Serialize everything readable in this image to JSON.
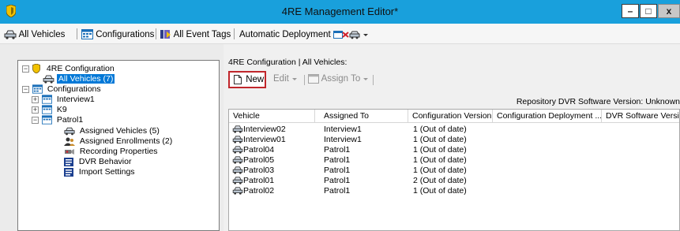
{
  "window": {
    "title": "4RE Management Editor*",
    "minimize": "–",
    "maximize": "□",
    "close": "x"
  },
  "toolbar": {
    "all_vehicles": "All Vehicles",
    "configurations": "Configurations",
    "all_event_tags": "All Event Tags",
    "automatic_deployment": "Automatic Deployment"
  },
  "tree": {
    "root": "4RE Configuration",
    "all_vehicles": "All Vehicles (7)",
    "configurations": "Configurations",
    "interview": "Interview1",
    "k9": "K9",
    "patrol": "Patrol1",
    "patrol_children": [
      "Assigned Vehicles (5)",
      "Assigned Enrollments (2)",
      "Recording Properties",
      "DVR Behavior",
      "Import Settings"
    ]
  },
  "breadcrumb": {
    "text": "4RE Configuration  |  All Vehicles:"
  },
  "commands": {
    "new": "New",
    "edit": "Edit",
    "assign_to": "Assign To"
  },
  "repository": "Repository DVR Software Version: Unknown",
  "table": {
    "headers": [
      "Vehicle",
      "Assigned To",
      "Configuration Version",
      "Configuration Deployment ...",
      "DVR Software Version"
    ],
    "rows": [
      {
        "vehicle": "Interview02",
        "assigned": "Interview1",
        "version": "1  (Out of date)"
      },
      {
        "vehicle": "Interview01",
        "assigned": "Interview1",
        "version": "1  (Out of date)"
      },
      {
        "vehicle": "Patrol04",
        "assigned": "Patrol1",
        "version": "1  (Out of date)"
      },
      {
        "vehicle": "Patrol05",
        "assigned": "Patrol1",
        "version": "1  (Out of date)"
      },
      {
        "vehicle": "Patrol03",
        "assigned": "Patrol1",
        "version": "1  (Out of date)"
      },
      {
        "vehicle": "Patrol01",
        "assigned": "Patrol1",
        "version": "2  (Out of date)"
      },
      {
        "vehicle": "Patrol02",
        "assigned": "Patrol1",
        "version": "1  (Out of date)"
      }
    ]
  },
  "colors": {
    "titlebar": "#19a0dc",
    "selection": "#0078d7",
    "highlight_border": "#c0262b"
  },
  "icons": [
    "shield-icon",
    "car-icon",
    "calendar-icon",
    "tag-icon",
    "truck-icon",
    "document-icon",
    "dropdown-icon",
    "assign-icon",
    "enrollment-icon",
    "recording-icon",
    "dvr-icon",
    "import-icon"
  ]
}
